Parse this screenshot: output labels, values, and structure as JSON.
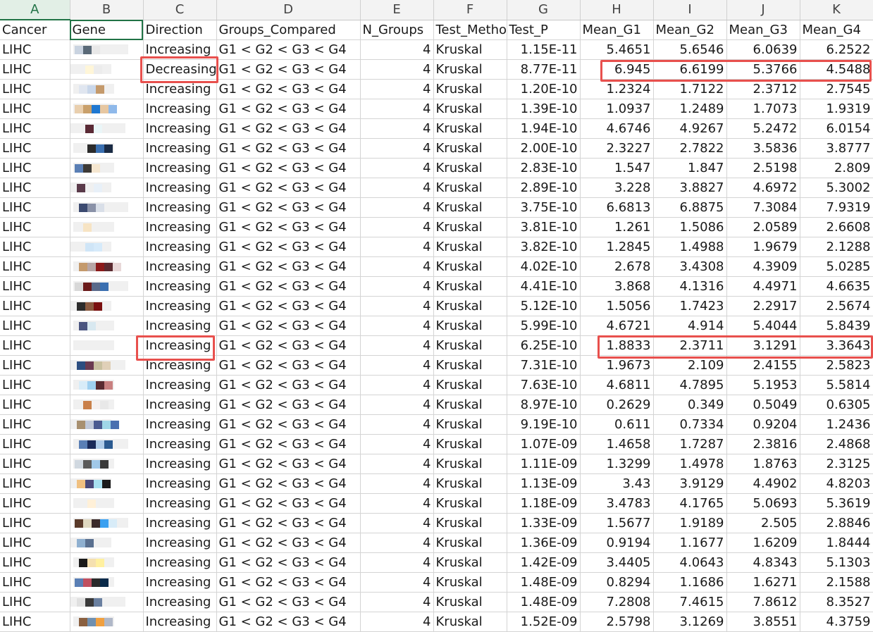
{
  "column_letters": [
    "A",
    "B",
    "C",
    "D",
    "E",
    "F",
    "G",
    "H",
    "I",
    "J",
    "K"
  ],
  "header": [
    "Cancer",
    "Gene",
    "Direction",
    "Groups_Compared",
    "N_Groups",
    "Test_Method",
    "Test_P",
    "Mean_G1",
    "Mean_G2",
    "Mean_G3",
    "Mean_G4"
  ],
  "rows": [
    [
      "LIHC",
      "",
      "Increasing",
      "G1 < G2 < G3 < G4",
      "4",
      "Kruskal",
      "1.15E-11",
      "5.4651",
      "5.6546",
      "6.0639",
      "6.2522"
    ],
    [
      "LIHC",
      "",
      "Decreasing",
      "G1 < G2 < G3 < G4",
      "4",
      "Kruskal",
      "8.77E-11",
      "6.945",
      "6.6199",
      "5.3766",
      "4.5488"
    ],
    [
      "LIHC",
      "",
      "Increasing",
      "G1 < G2 < G3 < G4",
      "4",
      "Kruskal",
      "1.20E-10",
      "1.2324",
      "1.7122",
      "2.3712",
      "2.7545"
    ],
    [
      "LIHC",
      "",
      "Increasing",
      "G1 < G2 < G3 < G4",
      "4",
      "Kruskal",
      "1.39E-10",
      "1.0937",
      "1.2489",
      "1.7073",
      "1.9319"
    ],
    [
      "LIHC",
      "",
      "Increasing",
      "G1 < G2 < G3 < G4",
      "4",
      "Kruskal",
      "1.94E-10",
      "4.6746",
      "4.9267",
      "5.2472",
      "6.0154"
    ],
    [
      "LIHC",
      "",
      "Increasing",
      "G1 < G2 < G3 < G4",
      "4",
      "Kruskal",
      "2.00E-10",
      "2.3227",
      "2.7822",
      "3.5836",
      "3.8777"
    ],
    [
      "LIHC",
      "",
      "Increasing",
      "G1 < G2 < G3 < G4",
      "4",
      "Kruskal",
      "2.83E-10",
      "1.547",
      "1.847",
      "2.5198",
      "2.809"
    ],
    [
      "LIHC",
      "",
      "Increasing",
      "G1 < G2 < G3 < G4",
      "4",
      "Kruskal",
      "2.89E-10",
      "3.228",
      "3.8827",
      "4.6972",
      "5.3002"
    ],
    [
      "LIHC",
      "",
      "Increasing",
      "G1 < G2 < G3 < G4",
      "4",
      "Kruskal",
      "3.75E-10",
      "6.6813",
      "6.8875",
      "7.3084",
      "7.9319"
    ],
    [
      "LIHC",
      "",
      "Increasing",
      "G1 < G2 < G3 < G4",
      "4",
      "Kruskal",
      "3.81E-10",
      "1.261",
      "1.5086",
      "2.0589",
      "2.6608"
    ],
    [
      "LIHC",
      "",
      "Increasing",
      "G1 < G2 < G3 < G4",
      "4",
      "Kruskal",
      "3.82E-10",
      "1.2845",
      "1.4988",
      "1.9679",
      "2.1288"
    ],
    [
      "LIHC",
      "",
      "Increasing",
      "G1 < G2 < G3 < G4",
      "4",
      "Kruskal",
      "4.02E-10",
      "2.678",
      "3.4308",
      "4.3909",
      "5.0285"
    ],
    [
      "LIHC",
      "",
      "Increasing",
      "G1 < G2 < G3 < G4",
      "4",
      "Kruskal",
      "4.41E-10",
      "3.868",
      "4.1316",
      "4.4971",
      "4.6635"
    ],
    [
      "LIHC",
      "",
      "Increasing",
      "G1 < G2 < G3 < G4",
      "4",
      "Kruskal",
      "5.12E-10",
      "1.5056",
      "1.7423",
      "2.2917",
      "2.5674"
    ],
    [
      "LIHC",
      "",
      "Increasing",
      "G1 < G2 < G3 < G4",
      "4",
      "Kruskal",
      "5.99E-10",
      "4.6721",
      "4.914",
      "5.4044",
      "5.8439"
    ],
    [
      "LIHC",
      "",
      "Increasing",
      "G1 < G2 < G3 < G4",
      "4",
      "Kruskal",
      "6.25E-10",
      "1.8833",
      "2.3711",
      "3.1291",
      "3.3643"
    ],
    [
      "LIHC",
      "",
      "Increasing",
      "G1 < G2 < G3 < G4",
      "4",
      "Kruskal",
      "7.31E-10",
      "1.9673",
      "2.109",
      "2.4155",
      "2.5823"
    ],
    [
      "LIHC",
      "",
      "Increasing",
      "G1 < G2 < G3 < G4",
      "4",
      "Kruskal",
      "7.63E-10",
      "4.6811",
      "4.7895",
      "5.1953",
      "5.5814"
    ],
    [
      "LIHC",
      "",
      "Increasing",
      "G1 < G2 < G3 < G4",
      "4",
      "Kruskal",
      "8.97E-10",
      "0.2629",
      "0.349",
      "0.5049",
      "0.6305"
    ],
    [
      "LIHC",
      "",
      "Increasing",
      "G1 < G2 < G3 < G4",
      "4",
      "Kruskal",
      "9.19E-10",
      "0.611",
      "0.7334",
      "0.9204",
      "1.2436"
    ],
    [
      "LIHC",
      "",
      "Increasing",
      "G1 < G2 < G3 < G4",
      "4",
      "Kruskal",
      "1.07E-09",
      "1.4658",
      "1.7287",
      "2.3816",
      "2.4868"
    ],
    [
      "LIHC",
      "",
      "Increasing",
      "G1 < G2 < G3 < G4",
      "4",
      "Kruskal",
      "1.11E-09",
      "1.3299",
      "1.4978",
      "1.8763",
      "2.3125"
    ],
    [
      "LIHC",
      "",
      "Increasing",
      "G1 < G2 < G3 < G4",
      "4",
      "Kruskal",
      "1.13E-09",
      "3.43",
      "3.9129",
      "4.4902",
      "4.8203"
    ],
    [
      "LIHC",
      "",
      "Increasing",
      "G1 < G2 < G3 < G4",
      "4",
      "Kruskal",
      "1.18E-09",
      "3.4783",
      "4.1765",
      "5.0693",
      "5.3619"
    ],
    [
      "LIHC",
      "",
      "Increasing",
      "G1 < G2 < G3 < G4",
      "4",
      "Kruskal",
      "1.33E-09",
      "1.5677",
      "1.9189",
      "2.505",
      "2.8846"
    ],
    [
      "LIHC",
      "",
      "Increasing",
      "G1 < G2 < G3 < G4",
      "4",
      "Kruskal",
      "1.36E-09",
      "0.9194",
      "1.1677",
      "1.6209",
      "1.8444"
    ],
    [
      "LIHC",
      "",
      "Increasing",
      "G1 < G2 < G3 < G4",
      "4",
      "Kruskal",
      "1.42E-09",
      "3.4405",
      "4.0643",
      "4.8343",
      "5.1303"
    ],
    [
      "LIHC",
      "",
      "Increasing",
      "G1 < G2 < G3 < G4",
      "4",
      "Kruskal",
      "1.48E-09",
      "0.8294",
      "1.1686",
      "1.6271",
      "2.1588"
    ],
    [
      "LIHC",
      "",
      "Increasing",
      "G1 < G2 < G3 < G4",
      "4",
      "Kruskal",
      "1.48E-09",
      "7.2808",
      "7.4615",
      "7.8612",
      "8.3527"
    ],
    [
      "LIHC",
      "",
      "Increasing",
      "G1 < G2 < G3 < G4",
      "4",
      "Kruskal",
      "1.52E-09",
      "2.5798",
      "3.1269",
      "3.8551",
      "4.3759"
    ]
  ],
  "gene_blocks": [
    [
      "#c9d3e0",
      "#5a6a78",
      "#e8e8e8"
    ],
    [
      "#f0f0f0",
      "#fff6d8",
      "#ececec"
    ],
    [
      "#e0e6f0",
      "#c9d7ea",
      "#c49a6c"
    ],
    [
      "#e9cfae",
      "#c9a06b",
      "#1f78d1",
      "#e7c7a1",
      "#8fb9ea"
    ],
    [
      "#f0f0f0",
      "#5a2a35",
      "#eaf6f8"
    ],
    [
      "#f0f0f0",
      "#2b2b2b",
      "#3a6fb0",
      "#1a2b44"
    ],
    [
      "#5a7fb5",
      "#3d3a36",
      "#f5e6cf"
    ],
    [
      "#5a3a4a",
      "#f0f0f0",
      "#e8f0f8"
    ],
    [
      "#3c4a70",
      "#8a92a8",
      "#d9dfe8"
    ],
    [
      "#f0f0f0",
      "#f7e4c4",
      "#f0f0f0"
    ],
    [
      "#f0f0f0",
      "#cfe5f7",
      "#d6eafa"
    ],
    [
      "#c49a6c",
      "#b7a6a6",
      "#8b1a1a",
      "#5a2a30",
      "#e8d8d8"
    ],
    [
      "#d8d8d8",
      "#6a1a1a",
      "#5a6a8a",
      "#3a6fb0"
    ],
    [
      "#2b2b2b",
      "#8a5a40",
      "#7a1010",
      "#f0f0f0"
    ],
    [
      "#4a5580",
      "#d8e8f0",
      "#f0f0f0"
    ],
    [
      "#f0f0f0",
      "#f0f0f0",
      "#f0f0f0"
    ],
    [
      "#2b4d80",
      "#6a3a50",
      "#c8c0a0",
      "#e0d0b8"
    ],
    [
      "#d8ecf8",
      "#9fd0f0",
      "#5a2a30",
      "#c88080"
    ],
    [
      "#f0f0f0",
      "#c9804a",
      "#f5f0f0",
      "#e8e8e8"
    ],
    [
      "#a89070",
      "#c0c8d8",
      "#4a5a90",
      "#9fd6e8",
      "#4a70b0"
    ],
    [
      "#5a7fb5",
      "#1a2b5a",
      "#aecbe8",
      "#2b5a90"
    ],
    [
      "#d0d8e0",
      "#5a5a5a",
      "#a0c8e8",
      "#3a3a3a"
    ],
    [
      "#f0c080",
      "#4a4a7a",
      "#a8e0f0",
      "#1a1a1a"
    ],
    [
      "#f0f0f0",
      "#fff0d8",
      "#f0f0f0"
    ],
    [
      "#5a3a2a",
      "#e0d8c0",
      "#3a2a2a",
      "#3aa0f0",
      "#d8ecf8"
    ],
    [
      "#8fb0d0",
      "#5a7090",
      "#f0f0f0"
    ],
    [
      "#1a1a1a",
      "#f5e0b0",
      "#fff0a0"
    ],
    [
      "#5a7fb5",
      "#c05060",
      "#2b2b2b",
      "#0a2a4a"
    ],
    [
      "#e0e0e0",
      "#3a3a3a",
      "#6a80a0"
    ],
    [
      "#8a6040",
      "#7090b0",
      "#f0a040",
      "#b0b8c8"
    ]
  ],
  "highlight_color": "#e8504d",
  "selection_color": "#217346"
}
